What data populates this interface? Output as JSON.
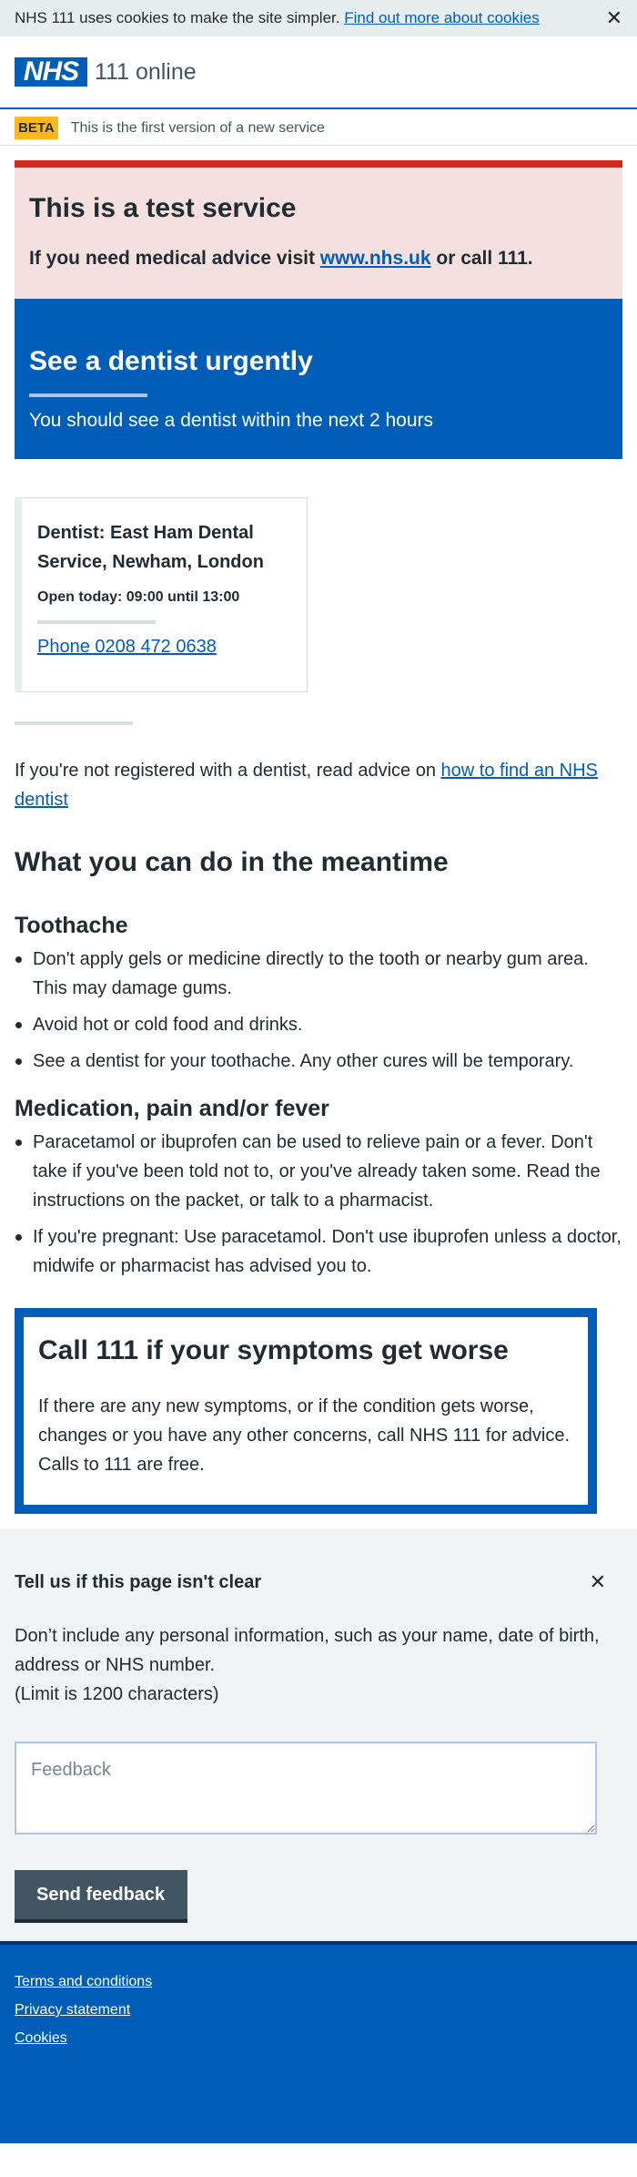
{
  "cookie_banner": {
    "text": "NHS 111 uses cookies to make the site simpler.",
    "link": "Find out more about cookies",
    "close": "✕"
  },
  "header": {
    "logo": "NHS",
    "service_name": "111 online"
  },
  "beta": {
    "tag": "BETA",
    "text": "This is the first version of a new service"
  },
  "test_panel": {
    "title": "This is a test service",
    "text_before": "If you need medical advice visit ",
    "link": "www.nhs.uk",
    "text_after": " or call 111."
  },
  "urgent": {
    "title": "See a dentist urgently",
    "subtitle": "You should see a dentist within the next 2 hours"
  },
  "dentist": {
    "name": "Dentist: East Ham Dental Service, Newham, London",
    "hours": "Open today: 09:00 until 13:00",
    "phone": "Phone 0208 472 0638"
  },
  "advice": {
    "text": "If you're not registered with a dentist, read advice on ",
    "link": "how to find an NHS dentist"
  },
  "meantime": {
    "title": "What you can do in the meantime",
    "sections": [
      {
        "heading": "Toothache",
        "items": [
          "Don't apply gels or medicine directly to the tooth or nearby gum area. This may damage gums.",
          "Avoid hot or cold food and drinks.",
          "See a dentist for your toothache. Any other cures will be temporary."
        ]
      },
      {
        "heading": "Medication, pain and/or fever",
        "items": [
          "Paracetamol or ibuprofen can be used to relieve pain or a fever. Don't take if you've been told not to, or you've already taken some. Read the instructions on the packet, or talk to a pharmacist.",
          "If you're pregnant: Use paracetamol. Don't use ibuprofen unless a doctor, midwife or pharmacist has advised you to."
        ]
      }
    ]
  },
  "care_card": {
    "title": "Call 111 if your symptoms get worse",
    "text": "If there are any new symptoms, or if the condition gets worse, changes or you have any other concerns, call NHS 111 for advice. Calls to 111 are free."
  },
  "feedback": {
    "title": "Tell us if this page isn't clear",
    "close": "✕",
    "text": "Don’t include any personal information, such as your name, date of birth, address or NHS number.",
    "limit": "(Limit is 1200 characters)",
    "placeholder": "Feedback",
    "button": "Send feedback"
  },
  "footer": {
    "links": [
      "Terms and conditions",
      "Privacy statement",
      "Cookies"
    ]
  },
  "colors": {
    "nhs_blue": "#005eb8",
    "red": "#d5281b",
    "warm_yellow": "#ffb81c"
  }
}
